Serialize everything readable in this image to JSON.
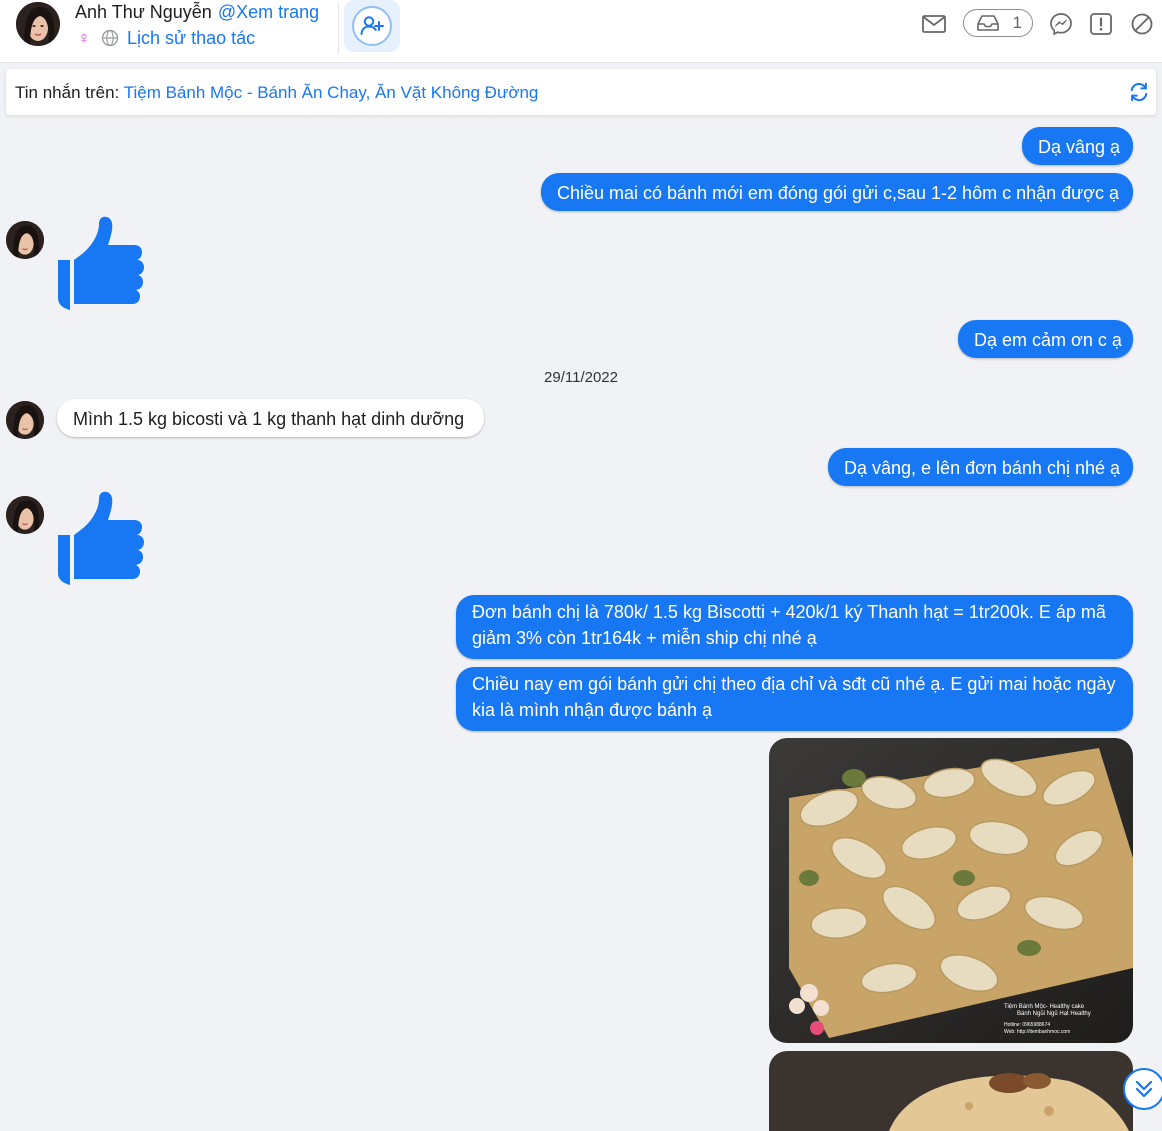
{
  "header": {
    "user_name": "Anh Thư Nguyễn",
    "view_page": "@Xem trang",
    "gender_symbol": "♀",
    "history_link": "Lịch sử thao tác",
    "inbox_count": "1",
    "icons": [
      "add-friend-icon",
      "mail-icon",
      "inbox-icon",
      "messenger-icon",
      "report-icon",
      "block-icon"
    ]
  },
  "infobar": {
    "label": "Tin nhắn trên:",
    "page_name": "Tiệm Bánh Mộc - Bánh Ăn Chay, Ăn Vặt Không Đường"
  },
  "date_separator": "29/11/2022",
  "messages": [
    {
      "direction": "out",
      "text": "Dạ vâng ạ"
    },
    {
      "direction": "out",
      "text": "Chiều mai có bánh mới em đóng gói gửi c,sau 1-2 hôm c nhận được ạ"
    },
    {
      "direction": "in",
      "type": "like"
    },
    {
      "direction": "out",
      "text": "Dạ em cảm ơn c ạ"
    },
    {
      "direction": "in",
      "text": "Mình 1.5 kg bicosti và 1 kg thanh hạt dinh dưỡng"
    },
    {
      "direction": "out",
      "text": "Dạ vâng, e lên đơn bánh chị nhé ạ"
    },
    {
      "direction": "in",
      "type": "like"
    },
    {
      "direction": "out",
      "text": "Đơn bánh chị là 780k/ 1.5 kg Biscotti + 420k/1 ký Thanh hạt = 1tr200k. E áp mã giảm 3% còn 1tr164k + miễn ship chị nhé ạ"
    },
    {
      "direction": "out",
      "text": "Chiều nay em gói bánh gửi chị theo địa chỉ và sđt cũ nhé ạ. E gửi mai hoặc ngày kia là mình nhận được bánh ạ"
    },
    {
      "direction": "out",
      "type": "photo",
      "subject": "nut-bar"
    },
    {
      "direction": "out",
      "type": "photo",
      "subject": "biscotti"
    }
  ],
  "photo_watermark": {
    "line1": "Tiệm Bánh Mộc- Healthy cake",
    "line2": "Bánh Ngũi Ngũ Hạt Healthy",
    "line3": "Hotline: 0965988674",
    "line4": "Web: http://tiembanhmoc.com"
  },
  "colors": {
    "accent": "#1877f2",
    "background": "#f1f2f5",
    "incoming_bubble": "#ffffff"
  }
}
